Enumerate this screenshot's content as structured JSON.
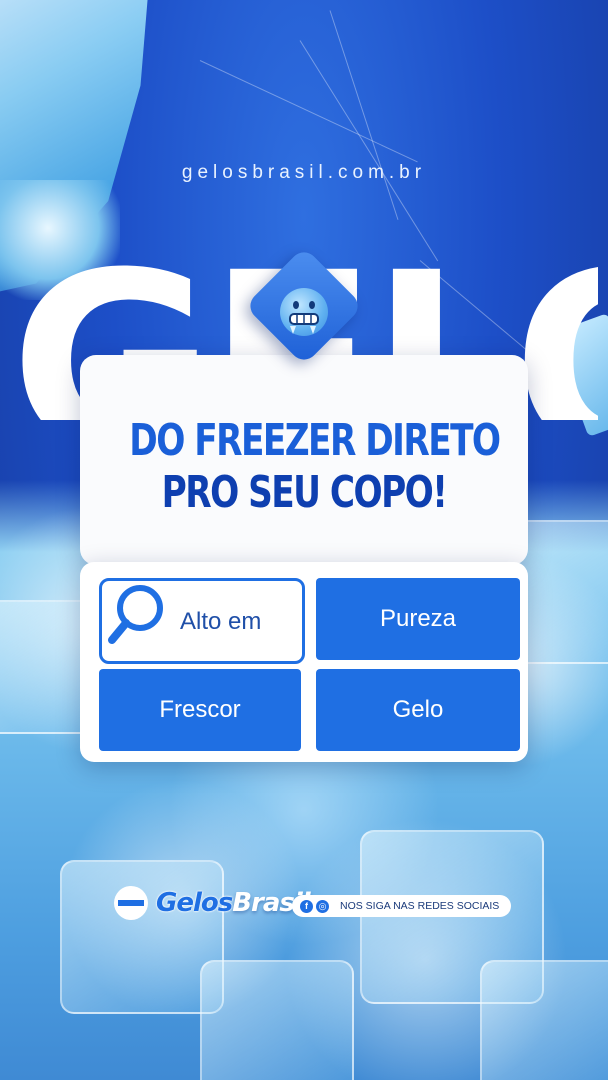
{
  "site_url": "gelosbrasil.com.br",
  "big_word": "GELO",
  "headline": {
    "line1": "DO FREEZER DIRETO",
    "line2": "PRO SEU COPO!"
  },
  "emoji": "cold-face-emoji",
  "search_tile": {
    "label": "Alto em",
    "icon": "magnifier-icon"
  },
  "tiles": [
    "Pureza",
    "Frescor",
    "Gelo"
  ],
  "brand": {
    "part1": "Gelos",
    "part2": "Brasil"
  },
  "social": {
    "text": "NOS SIGA NAS REDES SOCIAIS",
    "icons": [
      "facebook-icon",
      "instagram-icon"
    ]
  },
  "colors": {
    "primary": "#1f6fe3",
    "dark_blue": "#0e3fb0",
    "background": "#1d4fc8"
  }
}
